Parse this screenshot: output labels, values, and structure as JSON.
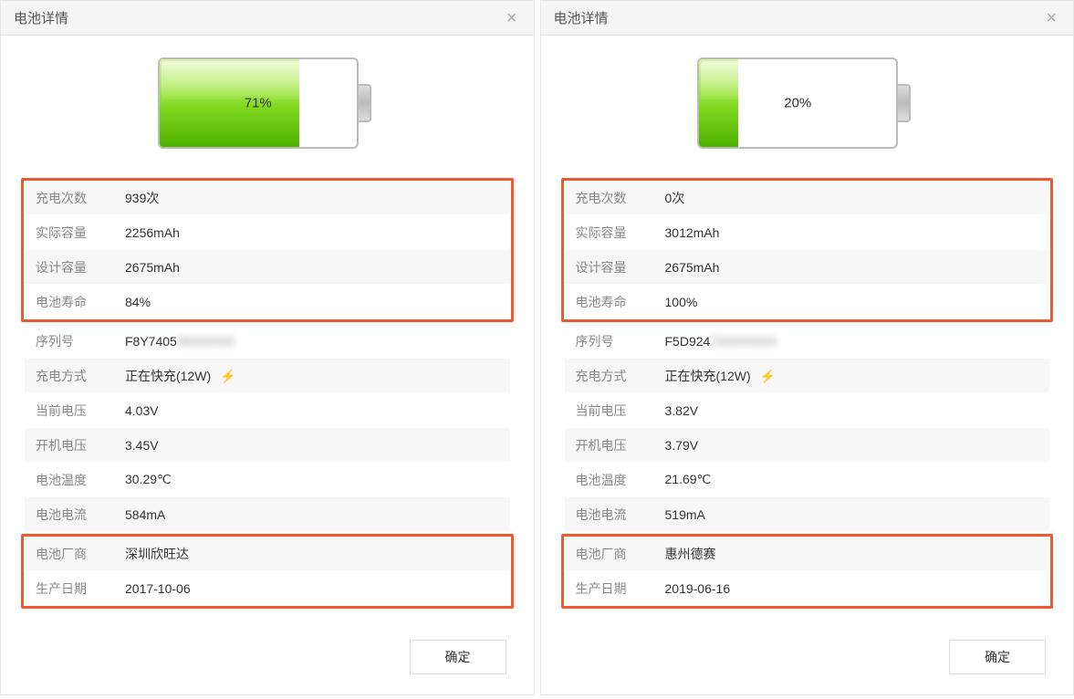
{
  "left": {
    "title": "电池详情",
    "percent_label": "71%",
    "percent_value": 71,
    "rows": {
      "charge_count": {
        "label": "充电次数",
        "value": "939次"
      },
      "actual_capacity": {
        "label": "实际容量",
        "value": "2256mAh"
      },
      "design_capacity": {
        "label": "设计容量",
        "value": "2675mAh"
      },
      "battery_life": {
        "label": "电池寿命",
        "value": "84%"
      },
      "serial": {
        "label": "序列号",
        "value_prefix": "F8Y7405",
        "value_blur": "0XXXXXX"
      },
      "charge_mode": {
        "label": "充电方式",
        "value": "正在快充(12W)"
      },
      "current_voltage": {
        "label": "当前电压",
        "value": "4.03V"
      },
      "boot_voltage": {
        "label": "开机电压",
        "value": "3.45V"
      },
      "temperature": {
        "label": "电池温度",
        "value": "30.29℃"
      },
      "current": {
        "label": "电池电流",
        "value": "584mA"
      },
      "manufacturer": {
        "label": "电池厂商",
        "value": "深圳欣旺达"
      },
      "production_date": {
        "label": "生产日期",
        "value": "2017-10-06"
      }
    },
    "ok": "确定"
  },
  "right": {
    "title": "电池详情",
    "percent_label": "20%",
    "percent_value": 20,
    "rows": {
      "charge_count": {
        "label": "充电次数",
        "value": "0次"
      },
      "actual_capacity": {
        "label": "实际容量",
        "value": "3012mAh"
      },
      "design_capacity": {
        "label": "设计容量",
        "value": "2675mAh"
      },
      "battery_life": {
        "label": "电池寿命",
        "value": "100%"
      },
      "serial": {
        "label": "序列号",
        "value_prefix": "F5D924",
        "value_blur": "7XXXXXXX"
      },
      "charge_mode": {
        "label": "充电方式",
        "value": "正在快充(12W)"
      },
      "current_voltage": {
        "label": "当前电压",
        "value": "3.82V"
      },
      "boot_voltage": {
        "label": "开机电压",
        "value": "3.79V"
      },
      "temperature": {
        "label": "电池温度",
        "value": "21.69℃"
      },
      "current": {
        "label": "电池电流",
        "value": "519mA"
      },
      "manufacturer": {
        "label": "电池厂商",
        "value": "惠州德赛"
      },
      "production_date": {
        "label": "生产日期",
        "value": "2019-06-16"
      }
    },
    "ok": "确定"
  },
  "highlight_color": "#ee592f"
}
